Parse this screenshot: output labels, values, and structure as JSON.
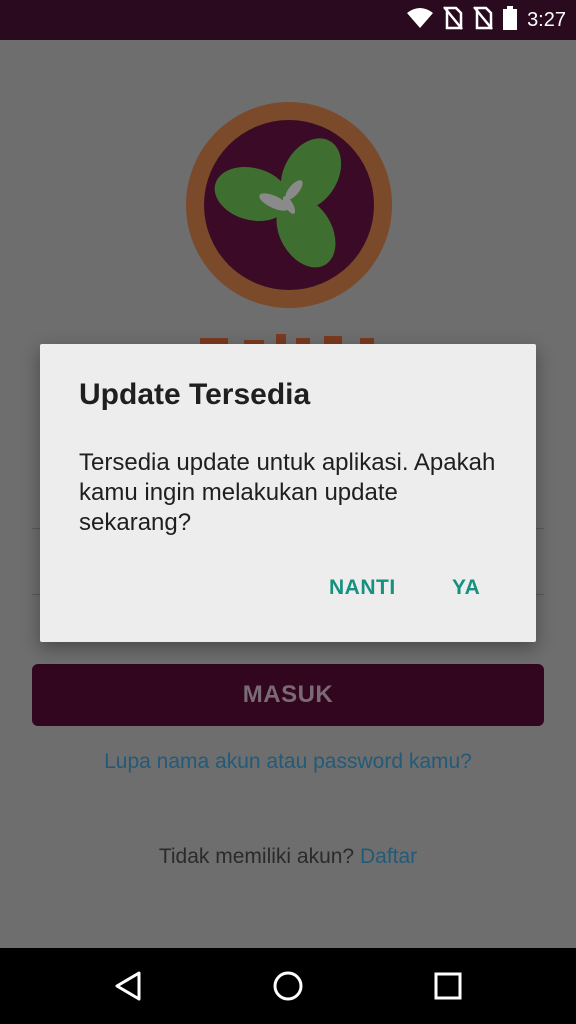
{
  "status_bar": {
    "time": "3:27",
    "icons": [
      "wifi-icon",
      "no-sim-icon",
      "no-sim-icon",
      "battery-icon"
    ]
  },
  "login": {
    "submit_label": "MASUK",
    "forgot_link": "Lupa nama akun atau password kamu?",
    "no_account_text": "Tidak memiliki akun?",
    "signup_link": "Daftar"
  },
  "dialog": {
    "title": "Update Tersedia",
    "message": "Tersedia update untuk aplikasi. Apakah kamu ingin melakukan update sekarang?",
    "negative_label": "NANTI",
    "positive_label": "YA"
  },
  "colors": {
    "status_bar": "#2a0a1f",
    "accent": "#16917f",
    "primary": "#33061f",
    "logo_ring": "#7a4a2a",
    "logo_leaf": "#3f6f30"
  },
  "nav_bar": {
    "icons": [
      "back-icon",
      "home-icon",
      "recents-icon"
    ]
  }
}
